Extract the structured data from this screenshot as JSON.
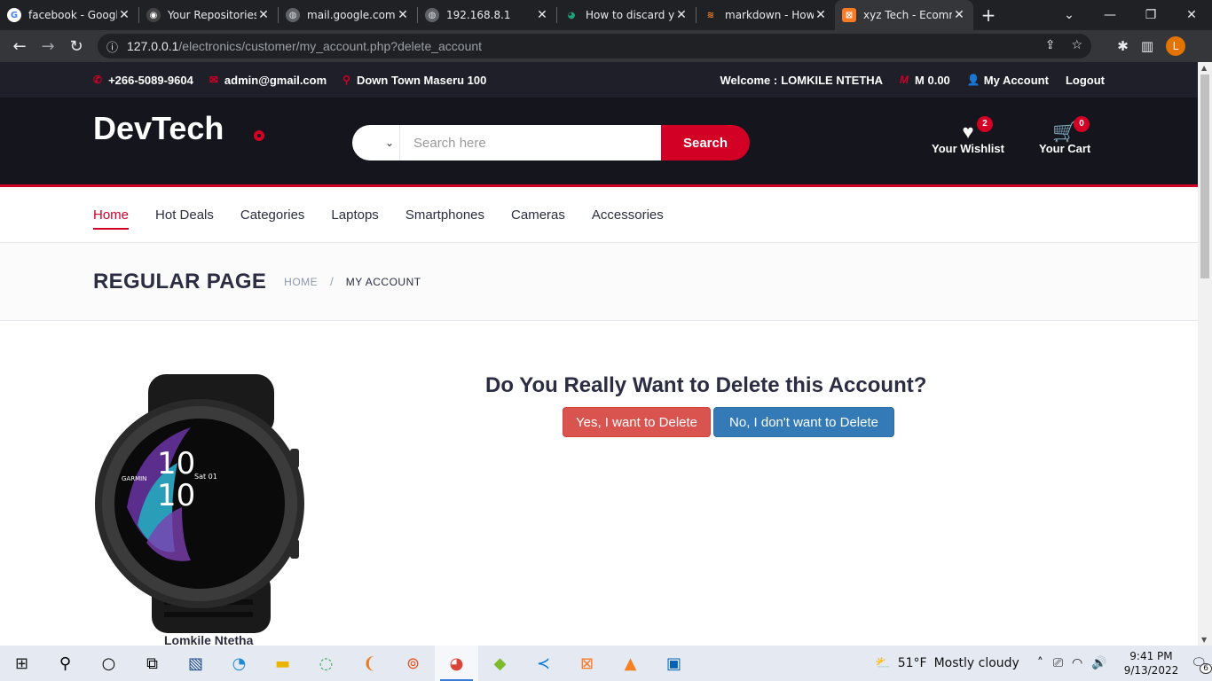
{
  "browser": {
    "tabs": [
      {
        "title": "facebook - Google",
        "icon": "google-icon"
      },
      {
        "title": "Your Repositories",
        "icon": "github-icon"
      },
      {
        "title": "mail.google.com",
        "icon": "globe-icon"
      },
      {
        "title": "192.168.8.1",
        "icon": "globe-icon"
      },
      {
        "title": "How to discard y",
        "icon": "eye-icon"
      },
      {
        "title": "markdown - How",
        "icon": "stackoverflow-icon"
      },
      {
        "title": "xyz Tech - Ecomm",
        "icon": "xampp-icon"
      }
    ],
    "url_host": "127.0.0.1",
    "url_path": "/electronics/customer/my_account.php?delete_account",
    "avatar_letter": "L"
  },
  "topbar": {
    "phone": "+266-5089-9604",
    "email": "admin@gmail.com",
    "location": "Down Town Maseru 100",
    "welcome_label": "Welcome :",
    "welcome_name": "LOMKILE NTETHA",
    "currency_symbol": "M",
    "balance": "M 0.00",
    "my_account": "My Account",
    "logout": "Logout"
  },
  "header": {
    "logo": "DevTech",
    "search_placeholder": "Search here",
    "search_button": "Search",
    "wishlist_label": "Your Wishlist",
    "wishlist_count": "2",
    "cart_label": "Your Cart",
    "cart_count": "0"
  },
  "nav": {
    "items": [
      "Home",
      "Hot Deals",
      "Categories",
      "Laptops",
      "Smartphones",
      "Cameras",
      "Accessories"
    ]
  },
  "breadcrumb": {
    "title": "REGULAR PAGE",
    "home": "HOME",
    "current": "MY ACCOUNT"
  },
  "content": {
    "question": "Do You Really Want to Delete this Account?",
    "yes_button": "Yes, I want to Delete",
    "no_button": "No, I don't want to Delete",
    "username_partial": "Lomkile Ntetha",
    "watch_face_brand": "GARMIN",
    "watch_time_hours": "10",
    "watch_time_minutes": "10",
    "watch_date": "Sat 01"
  },
  "taskbar": {
    "temperature": "51°F",
    "weather": "Mostly cloudy",
    "time": "9:41 PM",
    "date": "9/13/2022",
    "notifications": "6"
  },
  "colors": {
    "brand_red": "#d10024",
    "dark_bg": "#15161d",
    "danger": "#d9534f",
    "primary": "#337ab7"
  }
}
